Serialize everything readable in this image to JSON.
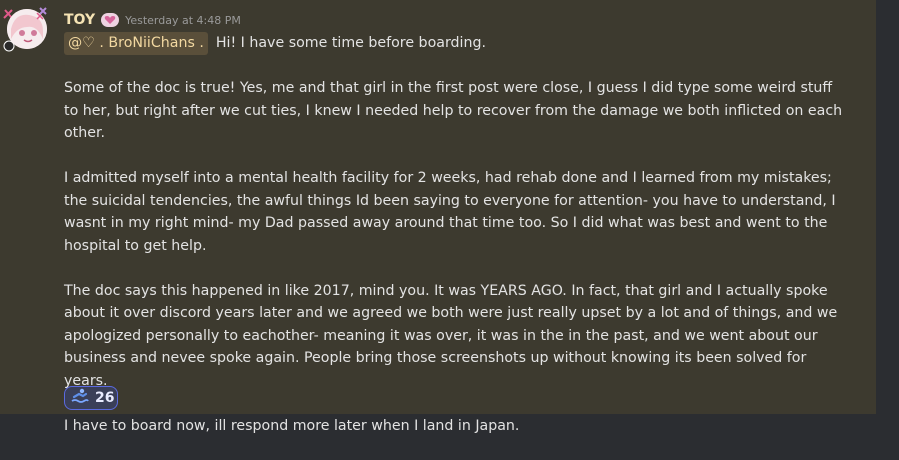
{
  "message": {
    "author": "TOY",
    "timestamp": "Yesterday at 4:48 PM",
    "mention": "@♡ . BroNiiChans .",
    "paragraphs": [
      "Hi! I have some time before boarding.",
      "Some of the doc is true! Yes, me and that girl in the first post were close, I guess I did type some weird stuff to her, but right after we cut ties, I knew I needed help to recover from the damage we both inflicted on each other.",
      "I admitted myself into a mental health facility for 2 weeks, had rehab done and I learned from my mistakes; the suicidal tendencies, the awful things Id been saying to everyone for attention- you have to understand, I wasnt in my right mind- my Dad passed away around that time too. So I did what was best and went to the hospital to get help.",
      "The doc says this happened in like 2017, mind you. It was YEARS AGO. In fact, that girl and I actually spoke about it over discord years later and we agreed we both were just really upset by a lot and of things, and we apologized personally to eachother- meaning it was over, it was in the in the past, and we went about our business and nevee spoke again. People bring those screenshots up without knowing its been solved for years.",
      "I have to board now, ill respond more later when I land in Japan."
    ],
    "reaction": {
      "icon": "swimmer-icon",
      "count": "26"
    }
  },
  "colors": {
    "background": "#3d3a2f",
    "author": "#f5e3b4",
    "text": "#e3e3e3",
    "reaction_border": "#5b6ae0"
  }
}
